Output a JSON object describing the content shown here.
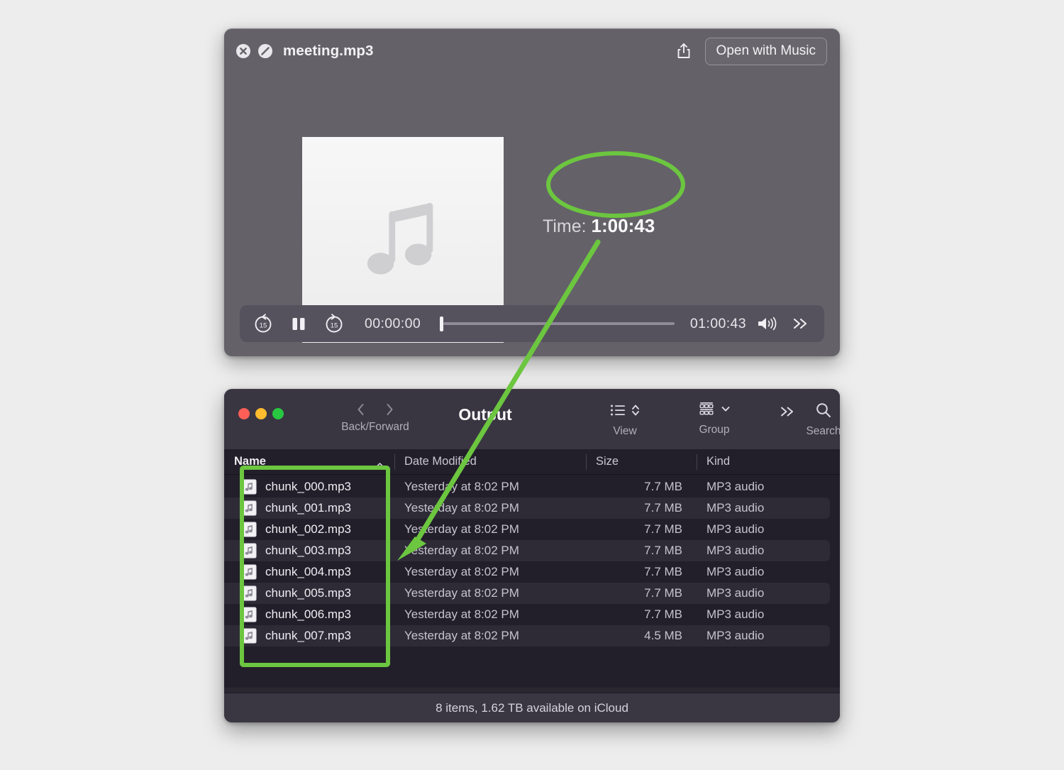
{
  "accent": {
    "green": "#6cc63f",
    "green_dark": "#5fba33"
  },
  "player": {
    "window_name": "quicklook-player",
    "title": "meeting.mp3",
    "close_icon": "close-circle-icon",
    "block_icon": "slash-circle-icon",
    "share_icon": "share-icon",
    "open_with_label": "Open with Music",
    "artwork_icon": "music-note-icon",
    "time_label": "Time:",
    "time_value": "1:00:43",
    "controls": {
      "skip_back_icon": "skip-back-15-icon",
      "skip_back_label": "15",
      "pause_icon": "pause-icon",
      "skip_forward_icon": "skip-forward-15-icon",
      "skip_forward_label": "15",
      "elapsed": "00:00:00",
      "duration": "01:00:43",
      "volume_icon": "volume-icon",
      "more_icon": "double-chevron-right-icon",
      "progress_percent": 0
    }
  },
  "finder": {
    "window_name": "finder-output",
    "title": "Output",
    "traffic_lights": [
      "close",
      "minimize",
      "zoom"
    ],
    "nav_label": "Back/Forward",
    "back_icon": "chevron-left-icon",
    "forward_icon": "chevron-right-icon",
    "toolbar": [
      {
        "label": "View",
        "icon": "list-view-icon",
        "chevron": "up-down-chevron-icon"
      },
      {
        "label": "Group",
        "icon": "group-grid-icon",
        "chevron": "chevron-down-icon"
      },
      {
        "label": "",
        "icon": "double-chevron-right-icon",
        "chevron": ""
      },
      {
        "label": "Search",
        "icon": "search-icon",
        "chevron": ""
      }
    ],
    "columns": [
      "Name",
      "Date Modified",
      "Size",
      "Kind"
    ],
    "sort_column": "Name",
    "sort_direction": "ascending",
    "rows": [
      {
        "name": "chunk_000.mp3",
        "date": "Yesterday at 8:02 PM",
        "size": "7.7 MB",
        "kind": "MP3 audio"
      },
      {
        "name": "chunk_001.mp3",
        "date": "Yesterday at 8:02 PM",
        "size": "7.7 MB",
        "kind": "MP3 audio"
      },
      {
        "name": "chunk_002.mp3",
        "date": "Yesterday at 8:02 PM",
        "size": "7.7 MB",
        "kind": "MP3 audio"
      },
      {
        "name": "chunk_003.mp3",
        "date": "Yesterday at 8:02 PM",
        "size": "7.7 MB",
        "kind": "MP3 audio"
      },
      {
        "name": "chunk_004.mp3",
        "date": "Yesterday at 8:02 PM",
        "size": "7.7 MB",
        "kind": "MP3 audio"
      },
      {
        "name": "chunk_005.mp3",
        "date": "Yesterday at 8:02 PM",
        "size": "7.7 MB",
        "kind": "MP3 audio"
      },
      {
        "name": "chunk_006.mp3",
        "date": "Yesterday at 8:02 PM",
        "size": "7.7 MB",
        "kind": "MP3 audio"
      },
      {
        "name": "chunk_007.mp3",
        "date": "Yesterday at 8:02 PM",
        "size": "4.5 MB",
        "kind": "MP3 audio"
      }
    ],
    "status": "8 items, 1.62 TB available on iCloud"
  },
  "annotations": {
    "ellipse_target": "time-value",
    "box_target": "file-name-column",
    "arrow_from": "time-value",
    "arrow_to": "chunk_003.mp3"
  }
}
